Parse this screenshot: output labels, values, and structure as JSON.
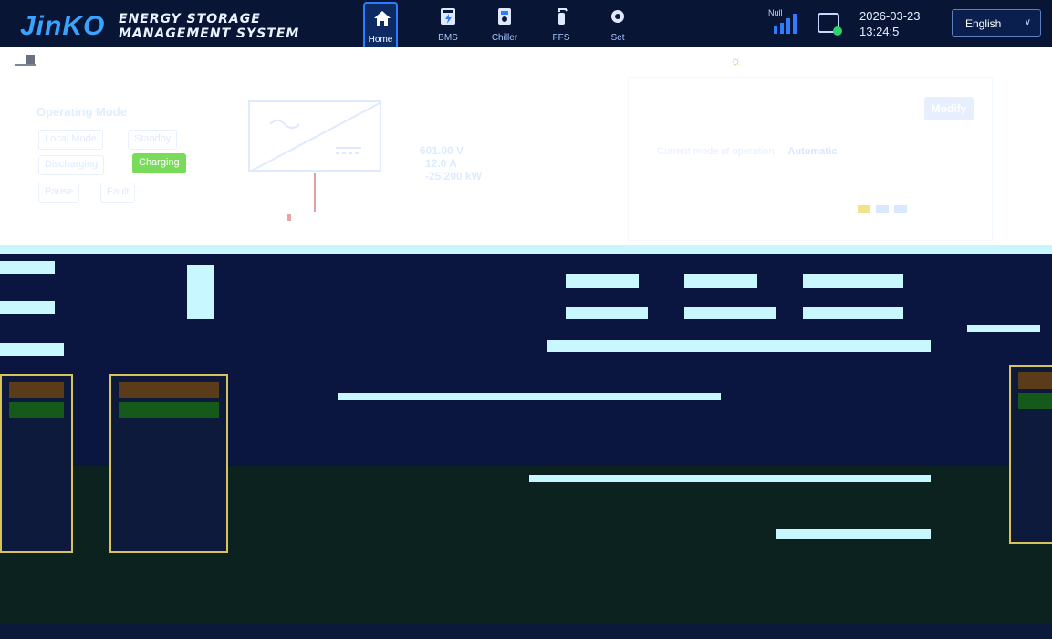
{
  "header": {
    "logo": "JinKO",
    "system_title_line1": "ENERGY STORAGE",
    "system_title_line2": "MANAGEMENT SYSTEM",
    "nav": [
      {
        "label": "Home",
        "icon": "home-icon",
        "active": true
      },
      {
        "label": "BMS",
        "icon": "battery-charge-icon",
        "active": false
      },
      {
        "label": "Chiller",
        "icon": "chiller-icon",
        "active": false
      },
      {
        "label": "FFS",
        "icon": "fire-extinguisher-icon",
        "active": false
      },
      {
        "label": "Set",
        "icon": "gear-icon",
        "active": false
      }
    ],
    "signal_label": "Null",
    "date": "2026-03-23",
    "time": "13:24:5",
    "language": "English"
  },
  "operating": {
    "title": "Operating Mode",
    "modes": [
      "Local Mode",
      "Standby",
      "Discharging",
      "Charging",
      "Pause",
      "Fault"
    ],
    "active_mode": "Charging"
  },
  "pcs": {
    "voltage": "601.00 V",
    "current": "12.0 A",
    "power": "-25.200 kW"
  },
  "right_panel": {
    "modify_label": "Modify",
    "current_mode_label": "Current mode of operation",
    "current_mode_value": "Automatic"
  },
  "colors": {
    "header_bg": "#081535",
    "accent": "#2d7cff",
    "charging": "#79db5a",
    "body_dark": "#0a1540"
  }
}
